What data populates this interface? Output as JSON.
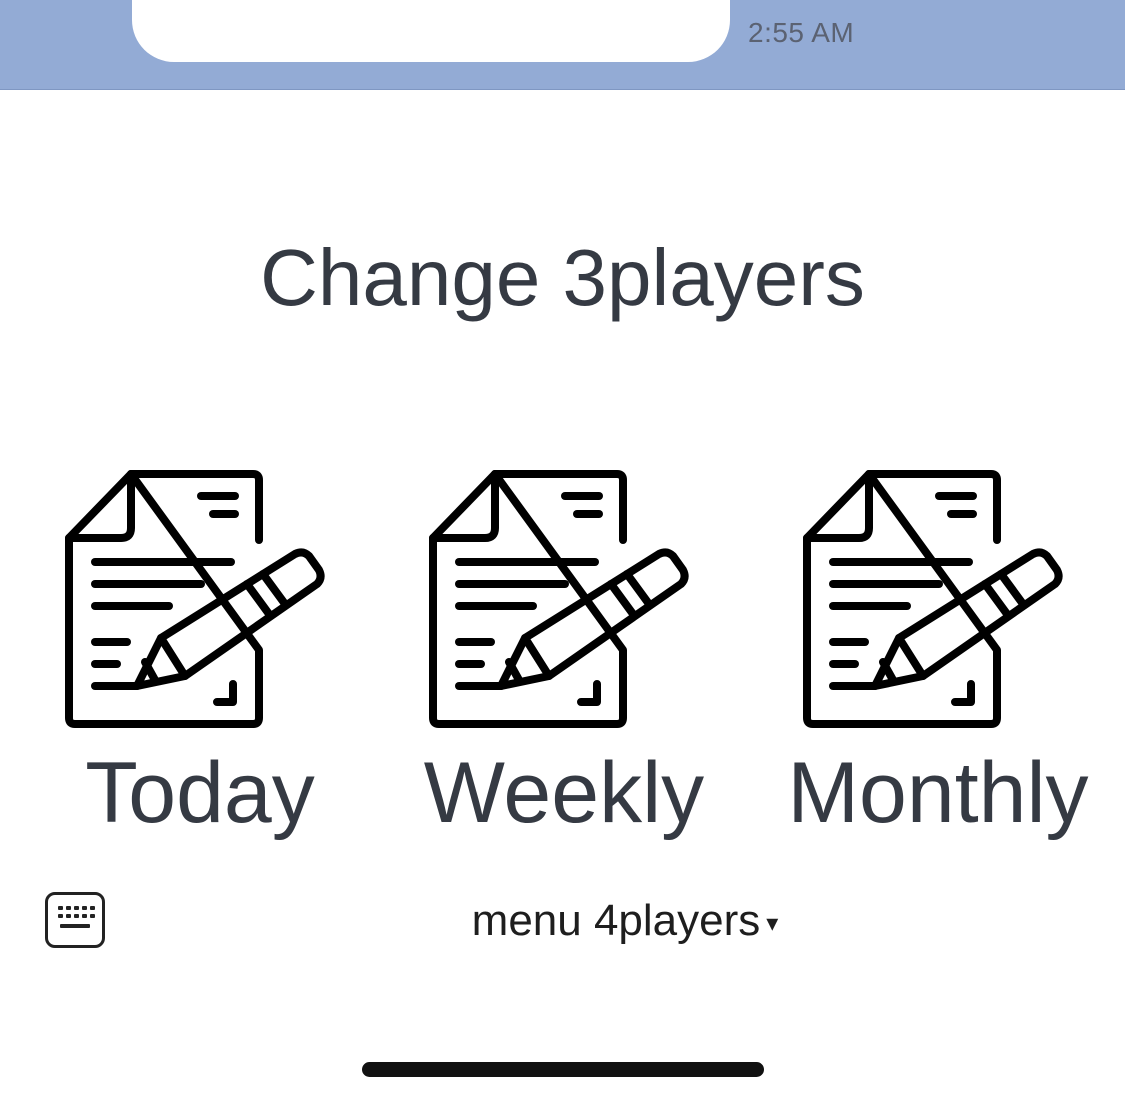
{
  "status_bar": {
    "time": "2:55 AM"
  },
  "page": {
    "title": "Change 3players"
  },
  "options": [
    {
      "label": "Today",
      "icon": "document-edit-icon"
    },
    {
      "label": "Weekly",
      "icon": "document-edit-icon"
    },
    {
      "label": "Monthly",
      "icon": "document-edit-icon"
    }
  ],
  "footer": {
    "menu_label": "menu 4players",
    "menu_caret": "▾",
    "keyboard_icon": "keyboard-icon"
  },
  "colors": {
    "status_bar_bg": "#93abd5",
    "text": "#353a43"
  }
}
